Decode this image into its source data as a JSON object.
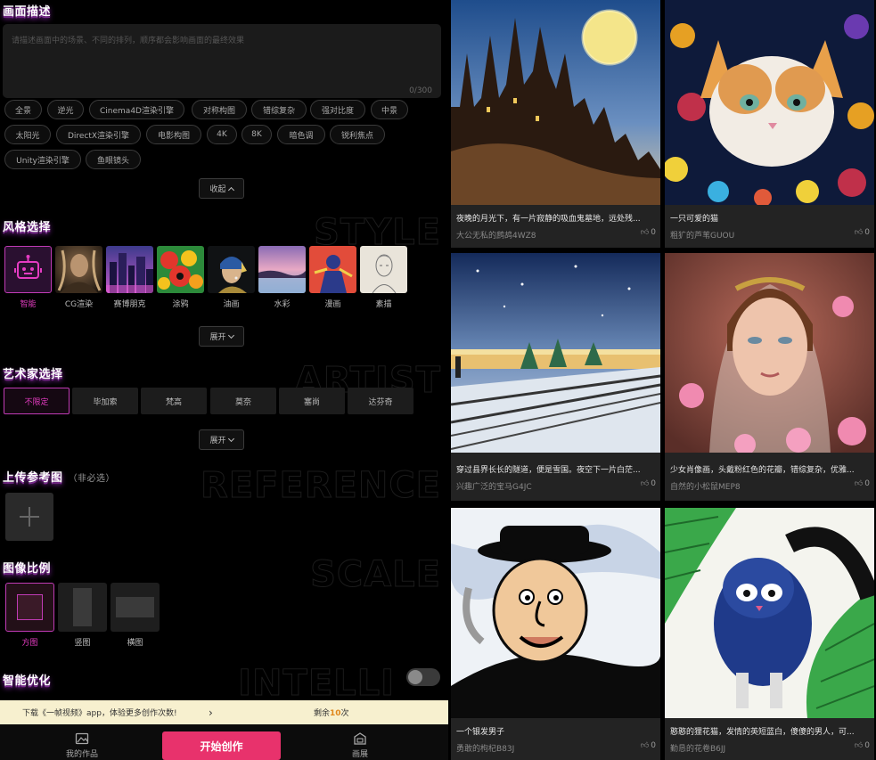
{
  "left": {
    "description": {
      "title": "画面描述",
      "placeholder": "请描述画面中的场景、不同的排列，顺序都会影响画面的最终效果",
      "count": "0/300",
      "chips_row1": [
        "全景",
        "逆光",
        "Cinema4D渲染引擎",
        "对称构图",
        "错综复杂",
        "强对比度",
        "中景"
      ],
      "chips_row2": [
        "太阳光",
        "DirectX渲染引擎",
        "电影构图",
        "4K",
        "8K",
        "暗色调",
        "锐利焦点"
      ],
      "chips_row3": [
        "Unity渲染引擎",
        "鱼眼镜头"
      ],
      "collapse_label": "收起"
    },
    "style": {
      "title": "风格选择",
      "watermark": "STYLE",
      "items": [
        "智能",
        "CG渲染",
        "赛博朋克",
        "涂鸦",
        "油画",
        "水彩",
        "漫画",
        "素描"
      ],
      "expand_label": "展开"
    },
    "artist": {
      "title": "艺术家选择",
      "watermark": "ARTIST",
      "items": [
        "不限定",
        "毕加索",
        "梵高",
        "莫奈",
        "塞尚",
        "达芬奇"
      ],
      "expand_label": "展开"
    },
    "upload": {
      "title": "上传参考图",
      "subtitle": "（非必选）",
      "watermark": "REFERENCE"
    },
    "ratio": {
      "title": "图像比例",
      "watermark": "SCALE",
      "items": [
        "方图",
        "竖图",
        "横图"
      ]
    },
    "smart": {
      "title": "智能优化",
      "watermark": "INTELLI"
    },
    "promo": {
      "text": "下载《一帧视频》app，体验更多创作次数!",
      "arrow": "›",
      "remaining_prefix": "剩余",
      "remaining_count": "10",
      "remaining_suffix": "次"
    },
    "bottom_nav": {
      "my_works": "我的作品",
      "start": "开始创作",
      "gallery": "画展"
    }
  },
  "gallery": {
    "cards": [
      {
        "title": "夜晚的月光下，有一片寂静的吸血鬼墓地，远处残...",
        "user": "大公无私的鹧鸪4WZ8",
        "likes": "0",
        "image": "castle-watercolor"
      },
      {
        "title": "一只可爱的猫",
        "user": "粗犷的芦苇GUOU",
        "likes": "0",
        "image": "kitten-flowers"
      },
      {
        "title": "穿过县界长长的隧道，便是雪国。夜空下一片白茫...",
        "user": "兴趣广泛的宝马G4JC",
        "likes": "0",
        "image": "snow-railway"
      },
      {
        "title": "少女肖像画，头戴粉红色的花瓣，错综复杂，优雅...",
        "user": "自然的小松鼠MEP8",
        "likes": "0",
        "image": "girl-portrait"
      },
      {
        "title": "一个银发男子",
        "user": "勇敢的枸杞B83J",
        "likes": "0",
        "image": "cartoon-man-hat"
      },
      {
        "title": "憨憨的狸花猫，发情的英短蓝白，傻傻的男人，可...",
        "user": "勤恳的花卷B6JJ",
        "likes": "0",
        "image": "raccoon-leaves"
      }
    ]
  }
}
